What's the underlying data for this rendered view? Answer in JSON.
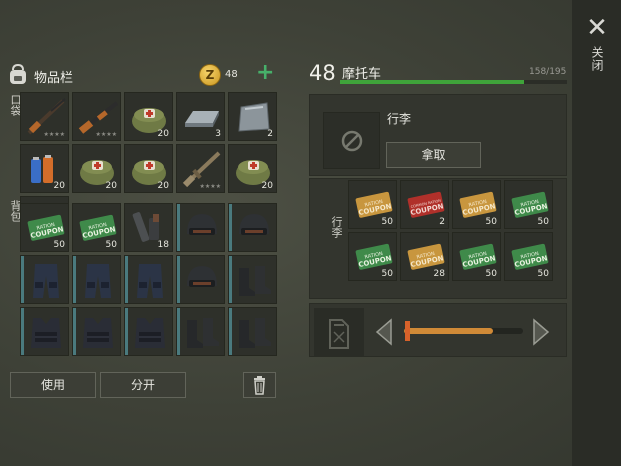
{
  "window": {
    "close_label": "关闭"
  },
  "inventory": {
    "title": "物品栏",
    "coin_symbol": "Z",
    "coins": "48",
    "pocket_label": "口袋",
    "bag_label": "背包",
    "pocket": [
      {
        "item": "rifle",
        "count": "",
        "stars": "★★★★"
      },
      {
        "item": "shotgun",
        "count": "",
        "stars": "★★★★"
      },
      {
        "item": "medkit-bag",
        "count": "20",
        "stars": ""
      },
      {
        "item": "metal-ingot",
        "count": "3",
        "stars": ""
      },
      {
        "item": "metal-plate",
        "count": "2",
        "stars": ""
      },
      {
        "item": "batteries",
        "count": "20",
        "stars": ""
      },
      {
        "item": "medkit-bag",
        "count": "20",
        "stars": ""
      },
      {
        "item": "medkit-bag",
        "count": "20",
        "stars": ""
      },
      {
        "item": "assault-rifle",
        "count": "",
        "stars": "★★★★"
      },
      {
        "item": "medkit-bag",
        "count": "20",
        "stars": ""
      },
      {
        "item": "medkit-bag",
        "count": "20",
        "stars": ""
      }
    ],
    "backpack": [
      {
        "item": "ration-coupon-green",
        "count": "50",
        "accent": false
      },
      {
        "item": "ration-coupon-green",
        "count": "50",
        "accent": false
      },
      {
        "item": "metal-parts",
        "count": "18",
        "accent": false
      },
      {
        "item": "tactical-helmet",
        "count": "",
        "accent": true
      },
      {
        "item": "tactical-helmet",
        "count": "",
        "accent": true
      },
      {
        "item": "tactical-pants",
        "count": "",
        "accent": true
      },
      {
        "item": "tactical-pants",
        "count": "",
        "accent": true
      },
      {
        "item": "tactical-pants",
        "count": "",
        "accent": true
      },
      {
        "item": "tactical-helmet",
        "count": "",
        "accent": true
      },
      {
        "item": "tactical-boots",
        "count": "",
        "accent": true
      },
      {
        "item": "tactical-vest",
        "count": "",
        "accent": true
      },
      {
        "item": "tactical-vest",
        "count": "",
        "accent": true
      },
      {
        "item": "tactical-vest",
        "count": "",
        "accent": true
      },
      {
        "item": "tactical-boots",
        "count": "",
        "accent": true
      },
      {
        "item": "tactical-boots",
        "count": "",
        "accent": true
      }
    ],
    "use_label": "使用",
    "split_label": "分开"
  },
  "vehicle": {
    "level": "48",
    "name": "摩托车",
    "durability": "158/195",
    "durability_fraction": 0.81,
    "trunk_title": "行李",
    "take_label": "拿取",
    "trunk_side_label": "行李",
    "coupon_text": "RATION COUPON",
    "coupon_text_red": "COMMON RATION COUPON",
    "items": [
      {
        "color": "gold",
        "count": "50"
      },
      {
        "color": "red",
        "count": "2"
      },
      {
        "color": "gold",
        "count": "50"
      },
      {
        "color": "green",
        "count": "50"
      },
      {
        "color": "green",
        "count": "50"
      },
      {
        "color": "gold",
        "count": "28"
      },
      {
        "color": "green",
        "count": "50"
      },
      {
        "color": "green",
        "count": "50"
      }
    ],
    "fuel_fraction": 0.75
  }
}
